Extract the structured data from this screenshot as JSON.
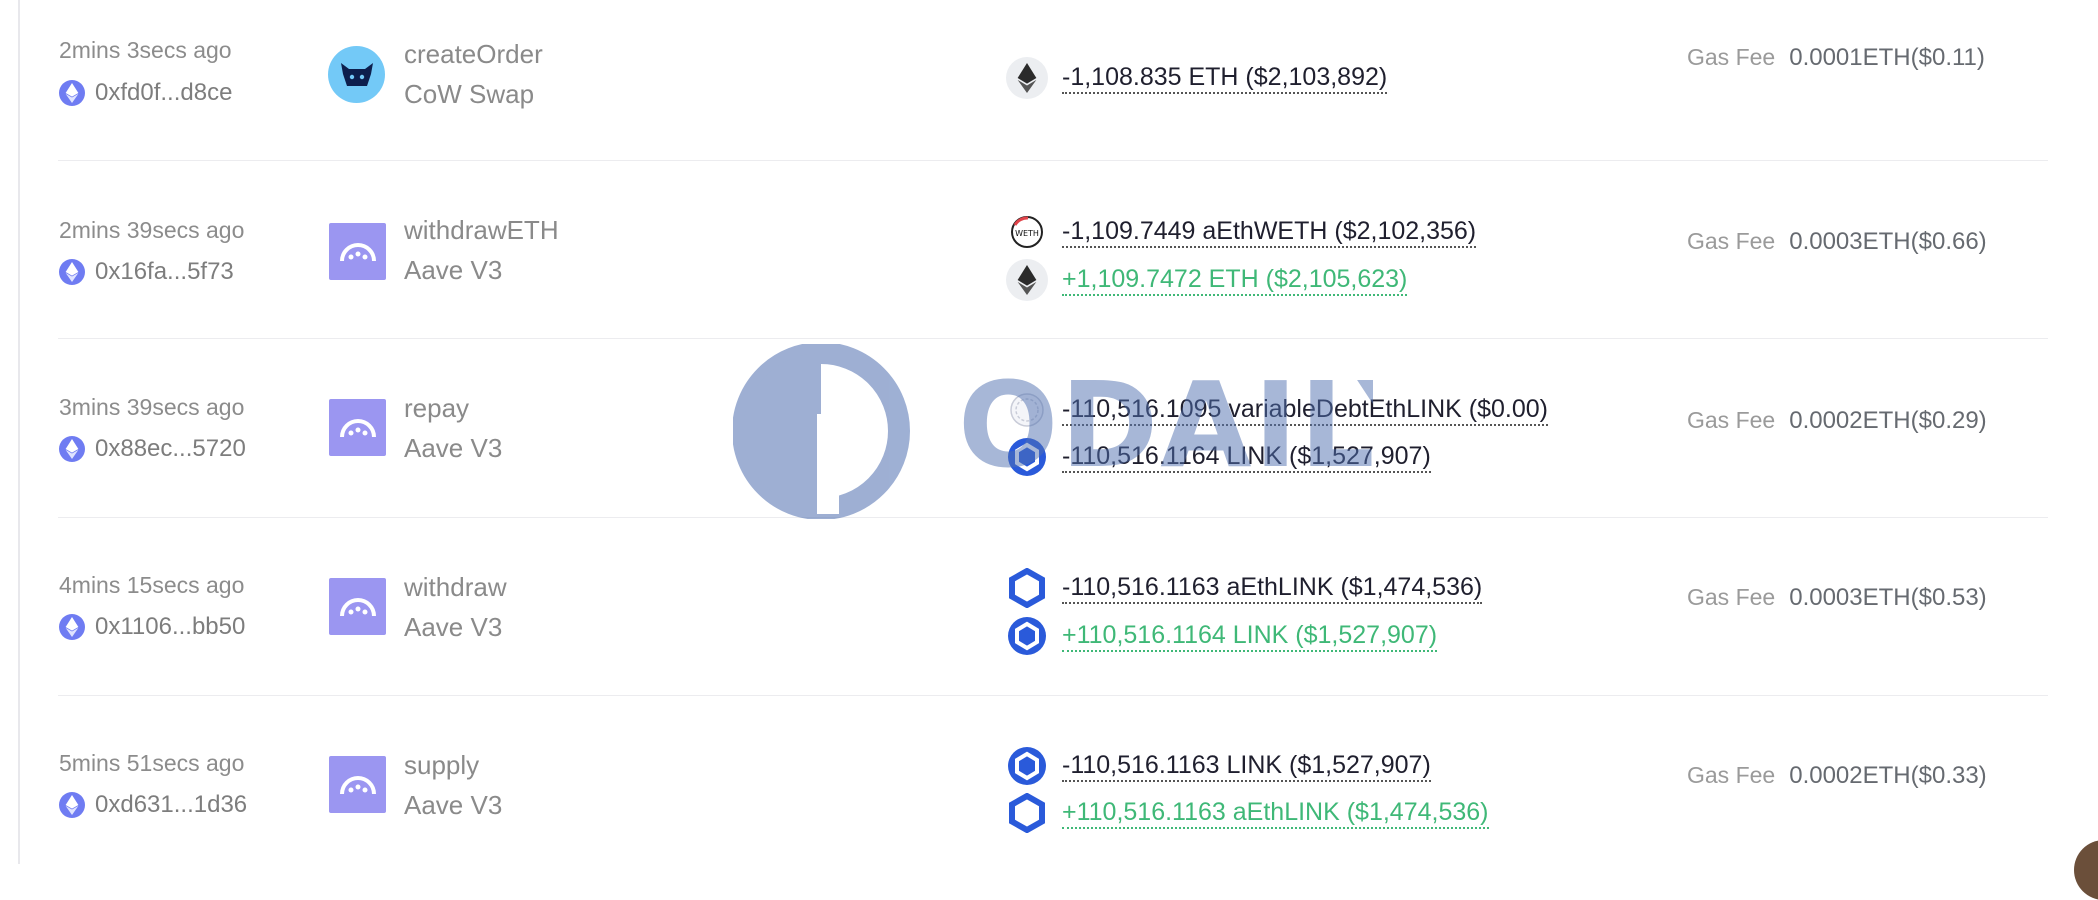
{
  "colors": {
    "negative": "#1f1f2e",
    "positive": "#3fb877",
    "aave_brand": "#9b96f1",
    "cow_brand": "#73c9f7",
    "eth_chip": "#6f7cf2",
    "link_brand": "#2a5ada"
  },
  "gas_label": "Gas Fee",
  "watermark": {
    "logo_icon": "odaily-logo-icon",
    "text": "ODAILY"
  },
  "rows": [
    {
      "time": "2mins 3secs ago",
      "hash": "0xfd0f...d8ce",
      "method": "createOrder",
      "protocol": "CoW Swap",
      "protocol_icon": "cow-icon",
      "gas": "0.0001ETH($0.11)",
      "transfers": [
        {
          "token_icon": "eth-icon",
          "amount": "-1,108.835 ETH ($2,103,892)",
          "direction": "negative"
        }
      ]
    },
    {
      "time": "2mins 39secs ago",
      "hash": "0x16fa...5f73",
      "method": "withdrawETH",
      "protocol": "Aave V3",
      "protocol_icon": "aave-ghost-icon",
      "gas": "0.0003ETH($0.66)",
      "transfers": [
        {
          "token_icon": "weth-icon",
          "amount": "-1,109.7449 aEthWETH ($2,102,356)",
          "direction": "negative"
        },
        {
          "token_icon": "eth-icon",
          "amount": "+1,109.7472 ETH ($2,105,623)",
          "direction": "positive"
        }
      ]
    },
    {
      "time": "3mins 39secs ago",
      "hash": "0x88ec...5720",
      "method": "repay",
      "protocol": "Aave V3",
      "protocol_icon": "aave-ghost-icon",
      "gas": "0.0002ETH($0.29)",
      "transfers": [
        {
          "token_icon": "variable-debt-icon",
          "amount": "-110,516.1095 variableDebtEthLINK ($0.00)",
          "direction": "negative"
        },
        {
          "token_icon": "link-icon",
          "amount": "-110,516.1164 LINK ($1,527,907)",
          "direction": "negative"
        }
      ]
    },
    {
      "time": "4mins 15secs ago",
      "hash": "0x1106...bb50",
      "method": "withdraw",
      "protocol": "Aave V3",
      "protocol_icon": "aave-ghost-icon",
      "gas": "0.0003ETH($0.53)",
      "transfers": [
        {
          "token_icon": "link-icon",
          "amount": "-110,516.1163 aEthLINK ($1,474,536)",
          "direction": "negative"
        },
        {
          "token_icon": "link-icon",
          "amount": "+110,516.1164 LINK ($1,527,907)",
          "direction": "positive"
        }
      ]
    },
    {
      "time": "5mins 51secs ago",
      "hash": "0xd631...1d36",
      "method": "supply",
      "protocol": "Aave V3",
      "protocol_icon": "aave-ghost-icon",
      "gas": "0.0002ETH($0.33)",
      "transfers": [
        {
          "token_icon": "link-icon",
          "amount": "-110,516.1163 LINK ($1,527,907)",
          "direction": "negative"
        },
        {
          "token_icon": "link-icon",
          "amount": "+110,516.1163 aEthLINK ($1,474,536)",
          "direction": "positive"
        }
      ]
    }
  ]
}
